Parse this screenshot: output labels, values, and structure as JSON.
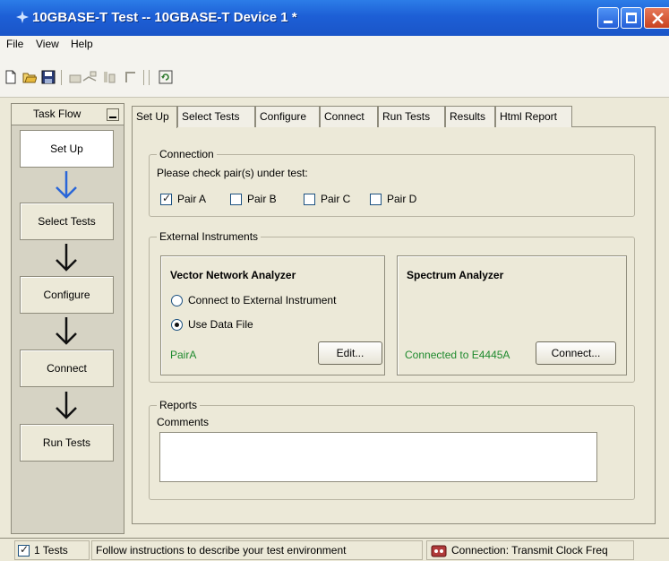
{
  "window": {
    "title": "10GBASE-T Test -- 10GBASE-T Device 1 *"
  },
  "menu": [
    "File",
    "View",
    "Help"
  ],
  "toolbar": {
    "icons": [
      "new-icon",
      "open-icon",
      "save-icon",
      "tool-icon-1",
      "tool-icon-2",
      "tool-icon-3",
      "tool-icon-4",
      "refresh-icon"
    ]
  },
  "taskflow": {
    "title": "Task Flow",
    "steps": [
      "Set Up",
      "Select Tests",
      "Configure",
      "Connect",
      "Run Tests"
    ],
    "active": "Set Up"
  },
  "tabs": [
    "Set Up",
    "Select Tests",
    "Configure",
    "Connect",
    "Run Tests",
    "Results",
    "Html Report"
  ],
  "setup": {
    "connection": {
      "label": "Connection",
      "prompt": "Please check pair(s) under test:",
      "pairs": [
        {
          "label": "Pair A",
          "checked": true
        },
        {
          "label": "Pair B",
          "checked": false
        },
        {
          "label": "Pair C",
          "checked": false
        },
        {
          "label": "Pair D",
          "checked": false
        }
      ]
    },
    "external_instruments": {
      "label": "External Instruments",
      "vna": {
        "title": "Vector Network Analyzer",
        "options": [
          {
            "label": "Connect to External Instrument",
            "selected": false
          },
          {
            "label": "Use Data File",
            "selected": true
          }
        ],
        "file_name": "PairA",
        "edit_label": "Edit..."
      },
      "spectrum": {
        "title": "Spectrum Analyzer",
        "status": "Connected to E4445A",
        "connect_label": "Connect..."
      }
    },
    "reports": {
      "label": "Reports",
      "comments_label": "Comments",
      "comments_value": ""
    }
  },
  "status": {
    "tests_label": "1 Tests",
    "tests_checked": true,
    "message": "Follow instructions to describe your test environment",
    "connection": "Connection: Transmit Clock Freq"
  },
  "colors": {
    "title_bar": "#1d5fd6",
    "accent_arrow": "#2a66d8",
    "status_green": "#1f8a2e",
    "panel": "#ece9d8"
  }
}
